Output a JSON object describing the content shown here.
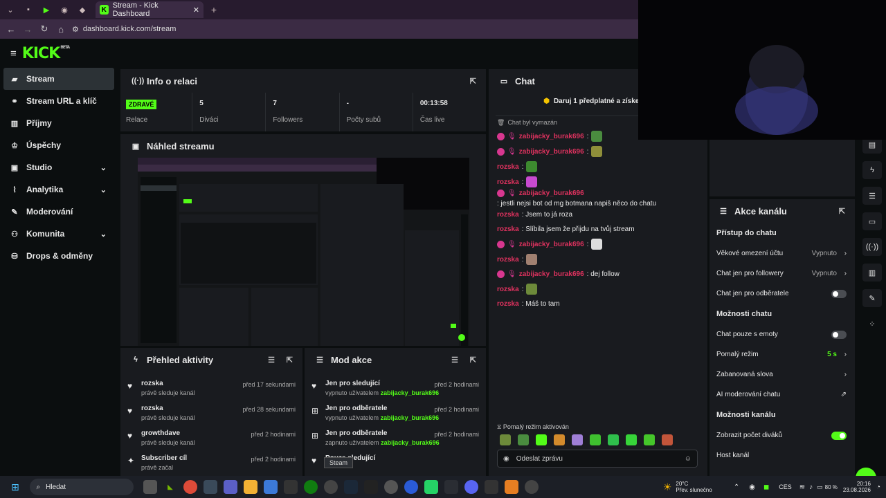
{
  "browser": {
    "tab_title": "Stream - Kick Dashboard",
    "new_tab": "+",
    "url": "dashboard.kick.com/stream"
  },
  "app": {
    "logo": "KICK",
    "beta": "BETA"
  },
  "sidebar": {
    "items": [
      {
        "label": "Stream",
        "icon": "stream-icon"
      },
      {
        "label": "Stream URL a klíč",
        "icon": "link-icon"
      },
      {
        "label": "Příjmy",
        "icon": "income-icon"
      },
      {
        "label": "Úspěchy",
        "icon": "trophy-icon"
      },
      {
        "label": "Studio",
        "icon": "studio-icon"
      },
      {
        "label": "Analytika",
        "icon": "analytics-icon"
      },
      {
        "label": "Moderování",
        "icon": "wrench-icon"
      },
      {
        "label": "Komunita",
        "icon": "community-icon"
      },
      {
        "label": "Drops & odměny",
        "icon": "drops-icon"
      }
    ]
  },
  "session": {
    "title": "Info o relaci",
    "status_badge": "ZDRAVÉ",
    "status_label": "Relace",
    "stats": [
      {
        "value": "5",
        "label": "Diváci"
      },
      {
        "value": "7",
        "label": "Followers"
      },
      {
        "value": "-",
        "label": "Počty subů"
      },
      {
        "value": "00:13:58",
        "label": "Čas live"
      }
    ]
  },
  "preview": {
    "title": "Náhled streamu"
  },
  "activity": {
    "title": "Přehled aktivity",
    "items": [
      {
        "title": "rozska",
        "sub": "právě sleduje kanál",
        "time": "před 17 sekundami"
      },
      {
        "title": "rozska",
        "sub": "právě sleduje kanál",
        "time": "před 28 sekundami"
      },
      {
        "title": "growthdave",
        "sub": "právě sleduje kanál",
        "time": "před 2 hodinami"
      },
      {
        "title": "Subscriber cíl",
        "sub": "právě začal",
        "time": "před 2 hodinami"
      }
    ]
  },
  "mod": {
    "title": "Mod akce",
    "items": [
      {
        "title": "Jen pro sledující",
        "sub": "vypnuto uživatelem",
        "user": "zabijacky_burak696",
        "time": "před 2 hodinami"
      },
      {
        "title": "Jen pro odběratele",
        "sub": "vypnuto uživatelem",
        "user": "zabijacky_burak696",
        "time": "před 2 hodinami"
      },
      {
        "title": "Jen pro odběratele",
        "sub": "zapnuto uživatelem",
        "user": "zabijacky_burak696",
        "time": "před 2 hodinami"
      },
      {
        "title": "Pouze sledující",
        "sub": "",
        "user": "",
        "time": ""
      }
    ],
    "tooltip": "Steam"
  },
  "chat": {
    "title": "Chat",
    "promo": "Daruj 1 předplatné a získej 1...",
    "cleared": "Chat byl vymazán",
    "messages": [
      {
        "user": "zabijacky_burak696",
        "text": ":",
        "badge": true
      },
      {
        "user": "zabijacky_burak696",
        "text": ":",
        "badge": true
      },
      {
        "user": "rozska",
        "text": ":",
        "badge": false
      },
      {
        "user": "rozska",
        "text": ":",
        "badge": false
      },
      {
        "user": "zabijacky_burak696",
        "text": ": jestli nejsi bot od mg botmana napiš něco do chatu",
        "badge": true
      },
      {
        "user": "rozska",
        "text": ": Jsem to já roza",
        "badge": false
      },
      {
        "user": "rozska",
        "text": ": Slíbila jsem že přijdu na tvůj stream",
        "badge": false
      },
      {
        "user": "zabijacky_burak696",
        "text": ":",
        "badge": true
      },
      {
        "user": "rozska",
        "text": ":",
        "badge": false
      },
      {
        "user": "zabijacky_burak696",
        "text": ": dej follow",
        "badge": true
      },
      {
        "user": "rozska",
        "text": ":",
        "badge": false
      },
      {
        "user": "rozska",
        "text": ": Máš to tam",
        "badge": false
      }
    ],
    "slow_mode": "Pomalý režim aktivován",
    "placeholder": "Odeslat zprávu"
  },
  "akce": {
    "title": "Akce kanálu",
    "sections": [
      {
        "heading": "Přístup do chatu",
        "rows": [
          {
            "label": "Věkové omezení účtu",
            "value": "Vypnuto",
            "type": "arrow"
          },
          {
            "label": "Chat jen pro followery",
            "value": "Vypnuto",
            "type": "arrow"
          },
          {
            "label": "Chat jen pro odběratele",
            "value": "",
            "type": "toggle-off"
          }
        ]
      },
      {
        "heading": "Možnosti chatu",
        "rows": [
          {
            "label": "Chat pouze s emoty",
            "value": "",
            "type": "toggle-off"
          },
          {
            "label": "Pomalý režim",
            "value": "5 s",
            "type": "arrow"
          },
          {
            "label": "Zabanovaná slova",
            "value": "",
            "type": "arrow"
          },
          {
            "label": "AI moderování chatu",
            "value": "",
            "type": "external"
          }
        ]
      },
      {
        "heading": "Možnosti kanálu",
        "rows": [
          {
            "label": "Zobrazit počet diváků",
            "value": "",
            "type": "toggle-on"
          },
          {
            "label": "Host kanál",
            "value": "",
            "type": "none"
          }
        ]
      }
    ]
  },
  "taskbar": {
    "search": "Hledat",
    "weather_temp": "20°C",
    "weather_desc": "Přev. slunečno",
    "lang": "CES",
    "battery": "80 %",
    "time": "20:16",
    "date": "23.08.2026"
  },
  "colors": {
    "accent": "#53fc18",
    "panel": "#191b1f",
    "bg": "#0b0e0f"
  }
}
